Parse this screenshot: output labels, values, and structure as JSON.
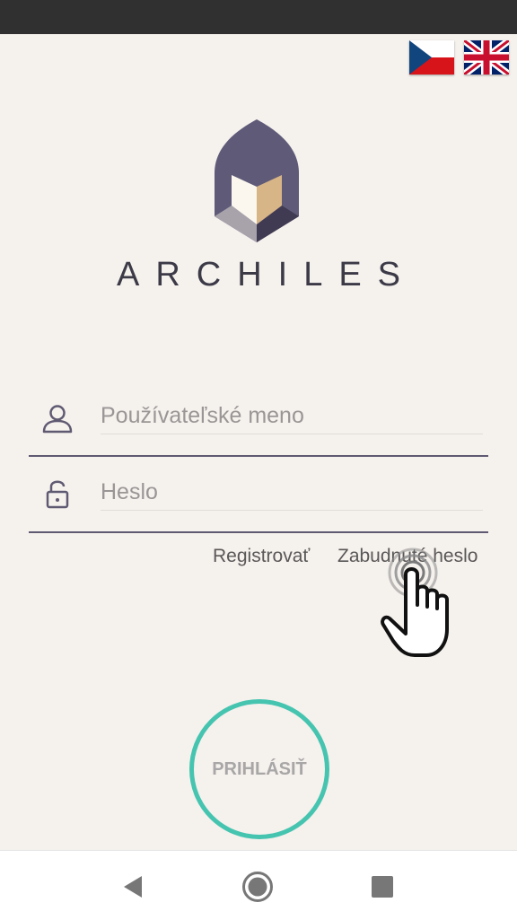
{
  "brand": {
    "name": "ARCHILES"
  },
  "language": {
    "options": [
      "cz-flag-icon",
      "gb-flag-icon"
    ]
  },
  "login_form": {
    "username_placeholder": "Používateľské meno",
    "password_placeholder": "Heslo",
    "register_label": "Registrovať",
    "forgot_label": "Zabudnuté heslo",
    "submit_label": "PRIHLÁSIŤ"
  },
  "colors": {
    "accent": "#45c4b0",
    "brand_purple": "#5f5a72",
    "background": "#f5f1ed",
    "status_bar": "#303030"
  },
  "navigation": {
    "buttons": [
      "back-icon",
      "home-icon",
      "recent-apps-icon"
    ]
  }
}
